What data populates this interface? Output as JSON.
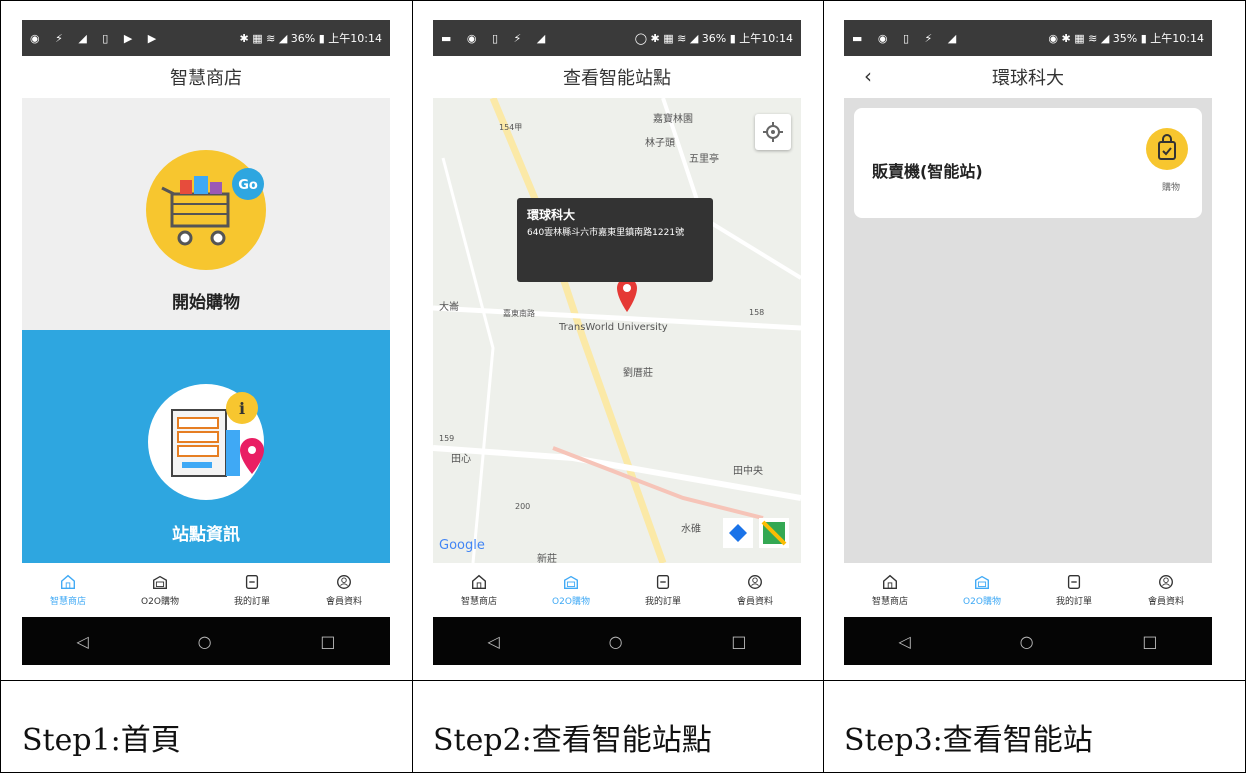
{
  "phones": [
    {
      "status_left": "◉ ⚡ ◢ ▯ ▶ ▶",
      "status_right": "✱ ▦ ≋ ◢ 36% ▮ 上午10:14",
      "title": "智慧商店",
      "start_shopping": "開始購物",
      "go_badge": "Go",
      "station_info": "站點資訊",
      "info_badge": "i"
    },
    {
      "status_left": "▬ ◉ ▯ ⚡ ◢",
      "status_right": "◯ ✱ ▦ ≋ ◢ 36% ▮ 上午10:14",
      "title": "查看智能站點",
      "popup_title": "環球科大",
      "popup_address": "640雲林縣斗六市嘉東里鎮南路1221號",
      "map_labels": [
        "嘉寶林園",
        "林子頭",
        "五里亭",
        "大崙",
        "嘉東南路",
        "TransWorld University",
        "劉厝莊",
        "田心",
        "田中央",
        "水碓",
        "新莊",
        "Google"
      ],
      "map_roads": [
        "154甲",
        "159",
        "158",
        "200"
      ]
    },
    {
      "status_left": "▬ ◉ ▯ ⚡ ◢",
      "status_right": "◉ ✱ ▦ ≋ ◢ 35% ▮ 上午10:14",
      "title": "環球科大",
      "back": "‹",
      "card_title": "販賣機(智能站)",
      "buy_label": "購物"
    }
  ],
  "tabs": [
    "智慧商店",
    "O2O購物",
    "我的訂單",
    "會員資料"
  ],
  "active_tabs": [
    0,
    1,
    1
  ],
  "nav": [
    "◁",
    "○",
    "□"
  ],
  "captions": [
    "Step1:首頁",
    "Step2:查看智能站點",
    "Step3:查看智能站"
  ],
  "colors": {
    "accent": "#3fa9f5",
    "blue_panel": "#2ea6e0",
    "yellow": "#f7c62f",
    "pin": "#e53935"
  }
}
